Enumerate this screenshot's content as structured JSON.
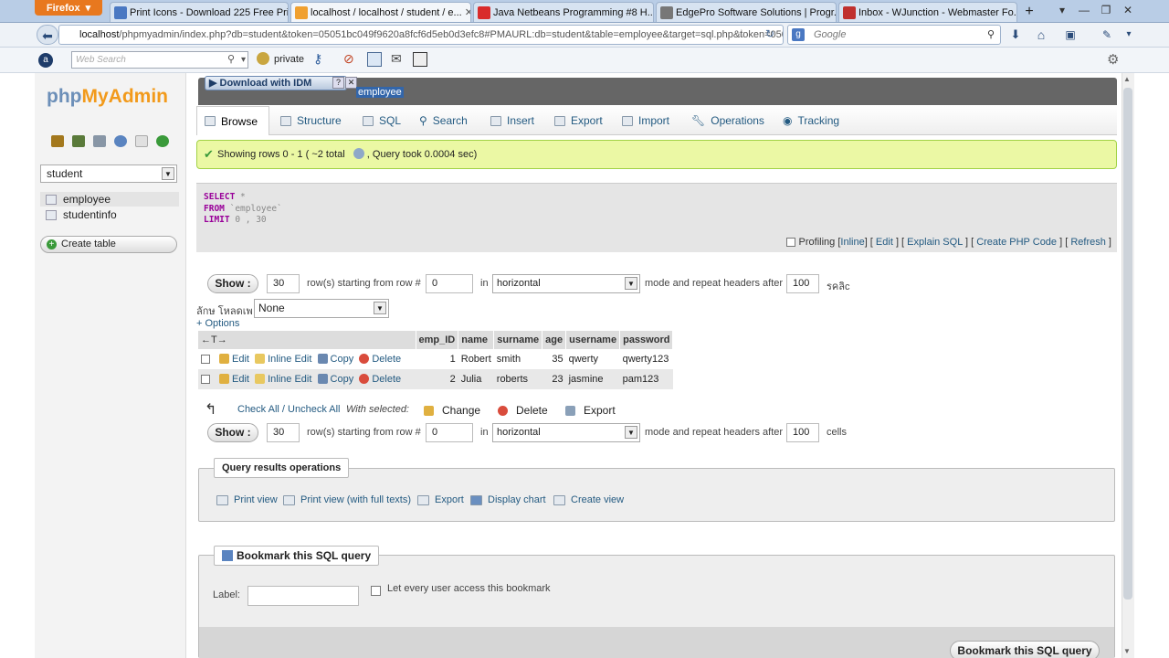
{
  "browser": {
    "menu_label": "Firefox",
    "tabs": [
      {
        "title": "Print Icons - Download 225 Free Pri...",
        "color": "#4a78c2"
      },
      {
        "title": "localhost / localhost / student / e...",
        "color": "#f0a030"
      },
      {
        "title": "Java Netbeans Programming #8 H...",
        "color": "#d92b2b"
      },
      {
        "title": "EdgePro Software Solutions | Progr...",
        "color": "#777777"
      },
      {
        "title": "Inbox - WJunction - Webmaster Fo...",
        "color": "#c0302e"
      }
    ],
    "url_host": "localhost",
    "url_rest": "/phpmyadmin/index.php?db=student&token=05051bc049f9620a8fcf6d5eb0d3efc8#PMAURL:db=student&table=employee&target=sql.php&token=050",
    "search_engine_placeholder": "Google",
    "websearch_placeholder": "Web Search",
    "private_label": "private"
  },
  "sidebar": {
    "logo_php": "php",
    "logo_myadmin": "MyAdmin",
    "database": "student",
    "tables": [
      "employee",
      "studentinfo"
    ],
    "create_table": "Create table"
  },
  "main": {
    "idm_label": "Download with IDM",
    "breadcrumb_table": "employee",
    "tabs": [
      "Browse",
      "Structure",
      "SQL",
      "Search",
      "Insert",
      "Export",
      "Import",
      "Operations",
      "Tracking"
    ],
    "success_msg": "Showing rows 0 - 1 ( ~2 total",
    "success_msg2": ", Query took 0.0004 sec)",
    "sql": {
      "select": "SELECT",
      "star": " *",
      "from": "FROM",
      "table": " `employee`",
      "limit": "LIMIT",
      "limit_vals": " 0 , 30"
    },
    "sql_links": {
      "profiling": "Profiling",
      "inline": "Inline",
      "edit": "Edit",
      "explain": "Explain SQL",
      "php": "Create PHP Code",
      "refresh": "Refresh"
    },
    "nav": {
      "show": "Show :",
      "rows": "30",
      "starting_label": "row(s) starting from row #",
      "start_row": "0",
      "in_label": "in",
      "mode": "horizontal",
      "mode_label": "mode and repeat headers after",
      "repeat": "100",
      "cells_label_top": "รคลิc",
      "cells_label": "cells"
    },
    "sort_label": "ลักษ โหลดเพ",
    "sort_value": "None",
    "options_link": "+ Options",
    "arrows": "←T→",
    "columns": [
      "emp_ID",
      "name",
      "surname",
      "age",
      "username",
      "password"
    ],
    "row_actions": {
      "edit": "Edit",
      "inline": "Inline Edit",
      "copy": "Copy",
      "delete": "Delete"
    },
    "rows": [
      {
        "emp_ID": "1",
        "name": "Robert",
        "surname": "smith",
        "age": "35",
        "username": "qwerty",
        "password": "qwerty123"
      },
      {
        "emp_ID": "2",
        "name": "Julia",
        "surname": "roberts",
        "age": "23",
        "username": "jasmine",
        "password": "pam123"
      }
    ],
    "bulk": {
      "check_all": "Check All / Uncheck All",
      "with_selected": "With selected:",
      "change": "Change",
      "delete": "Delete",
      "export": "Export"
    },
    "qro": {
      "legend": "Query results operations",
      "print_view": "Print view",
      "print_full": "Print view (with full texts)",
      "export": "Export",
      "chart": "Display chart",
      "create_view": "Create view"
    },
    "bookmark": {
      "legend": "Bookmark this SQL query",
      "label": "Label:",
      "every_user": "Let every user access this bookmark",
      "submit": "Bookmark this SQL query"
    }
  }
}
